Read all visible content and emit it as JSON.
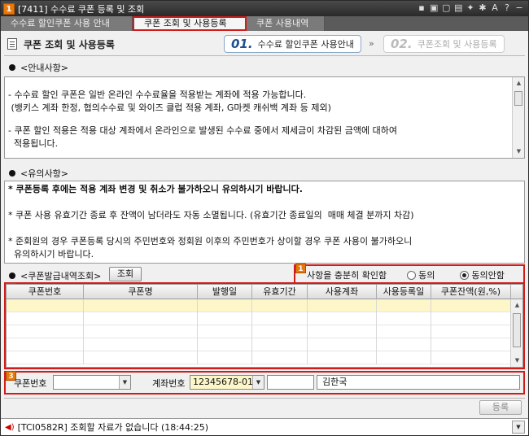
{
  "window": {
    "number": "1",
    "title": "[7411] 수수료 쿠폰 등록 및 조회",
    "icons": [
      "pin-icon",
      "window-icon",
      "box-icon",
      "lock-icon",
      "link-icon",
      "asterisk-icon",
      "font-icon",
      "help-icon",
      "close-icon"
    ]
  },
  "tabs": [
    {
      "label": "수수료 할인쿠폰 사용 안내",
      "active": false
    },
    {
      "label": "쿠폰 조회 및 사용등록",
      "active": true
    },
    {
      "label": "쿠폰 사용내역",
      "active": false
    }
  ],
  "header": {
    "title": "쿠폰 조회 및 사용등록",
    "step1_num": "01.",
    "step1_label": "수수료 할인쿠폰 사용안내",
    "arrow": "»",
    "step2_num": "02.",
    "step2_label": "쿠폰조회 및 사용등록"
  },
  "guide": {
    "label": "<안내사항>",
    "lines": [
      "- 수수료 할인 쿠폰은 일반 온라인 수수료율을 적용받는 계좌에 적용 가능합니다.",
      " (뱅키스 계좌 한정, 협의수수료 및 와이즈 클럽 적용 계좌, G마켓 캐쉬백 계좌 등 제외)",
      "",
      "- 쿠폰 할인 적용은 적용 대상 계좌에서 온라인으로 발생된 수수료 중에서 제세금이 차감된 금액에 대하여",
      "  적용됩니다."
    ]
  },
  "notice": {
    "label": "<유의사항>",
    "line1": "* 쿠폰등록 후에는 적용 계좌 변경 및 취소가 불가하오니 유의하시기 바랍니다.",
    "line2": "* 쿠폰 사용 유효기간 종료 후 잔액이 남더라도 자동 소멸됩니다. (유효기간 종료일의  매매 체결 분까지 차감)",
    "line3": "* 준회원의 경우 쿠폰등록 당시의 주민번호와 정회원 이후의 주민번호가 상이할 경우 쿠폰 사용이 불가하오니",
    "line4": "  유의하시기 바랍니다."
  },
  "query": {
    "label": "<쿠폰발급내역조회>",
    "button": "조회",
    "badge1": "1",
    "agree_text": "사항을 충분히 확인함",
    "agree": "동의",
    "disagree": "동의안함",
    "selected": "동의안함"
  },
  "grid": {
    "badge": "2",
    "columns": [
      "쿠폰번호",
      "쿠폰명",
      "발행일",
      "유효기간",
      "사용계좌",
      "사용등록일",
      "쿠폰잔액(원,%)"
    ]
  },
  "form": {
    "badge": "3",
    "coupon_no_label": "쿠폰번호",
    "coupon_no_value": "",
    "account_label": "계좌번호",
    "account_value": "12345678-01",
    "password_value": "",
    "owner_name": "김한국",
    "register_button": "등록"
  },
  "status": {
    "message": "[TCI0582R] 조회할 자료가 없습니다 (18:44:25)"
  }
}
